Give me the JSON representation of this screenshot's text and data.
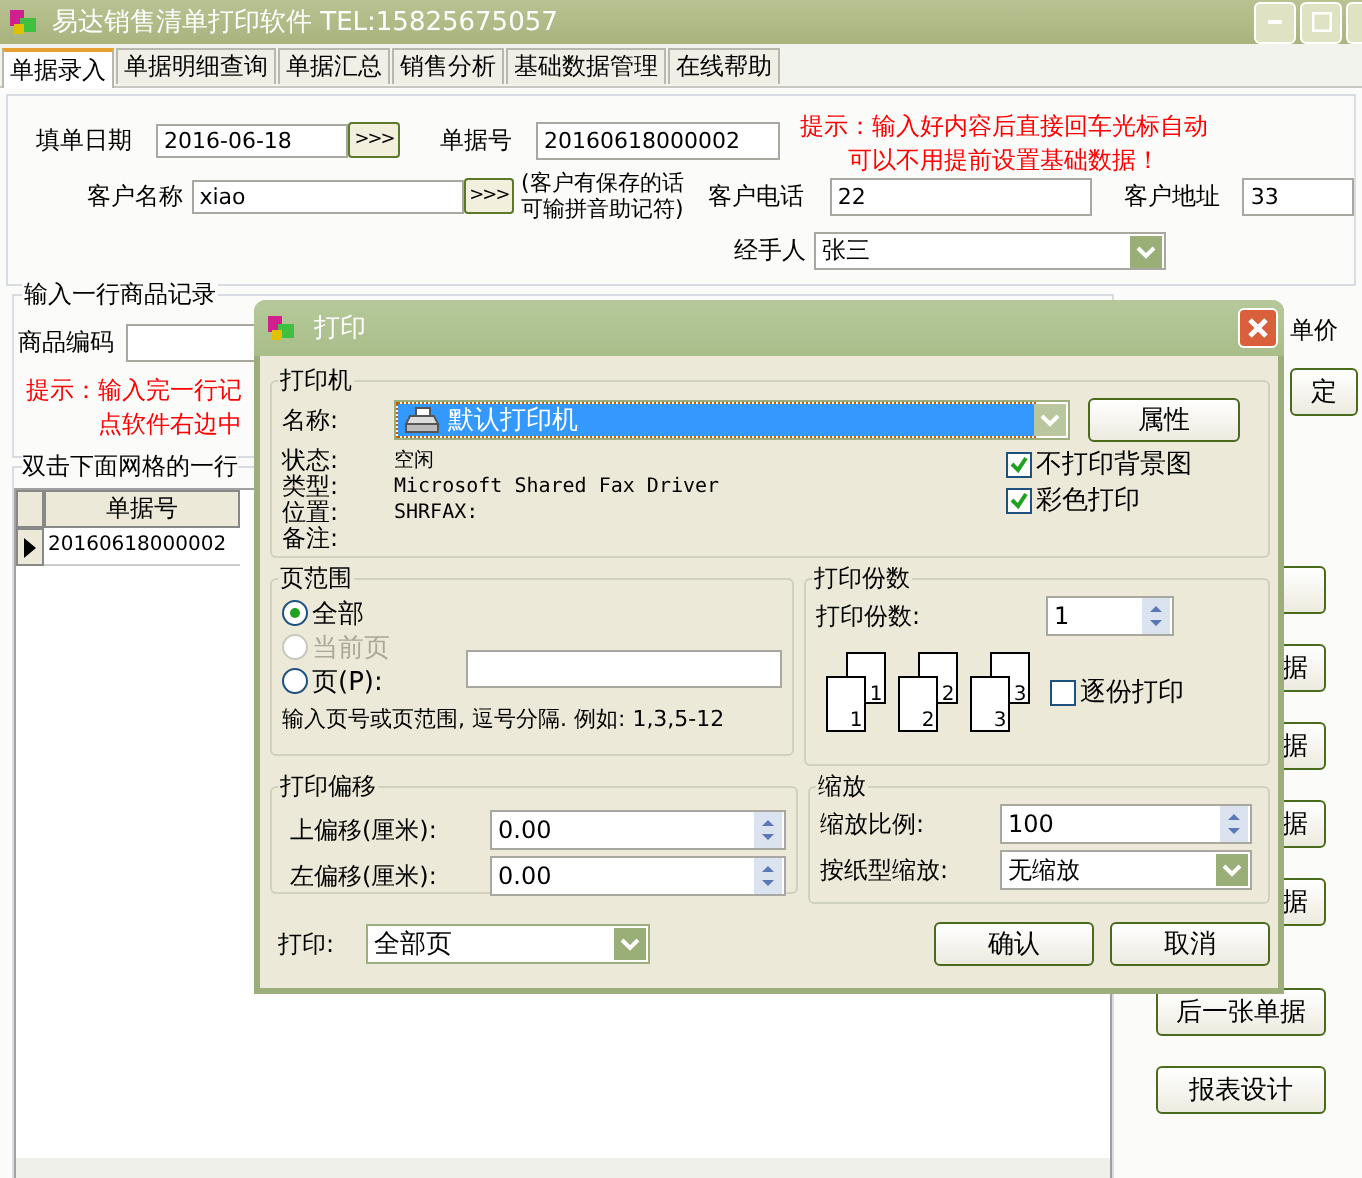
{
  "window": {
    "title": "易达销售清单打印软件 TEL:15825675057"
  },
  "tabs": [
    {
      "label": "单据录入",
      "selected": true
    },
    {
      "label": "单据明细查询",
      "selected": false
    },
    {
      "label": "单据汇总",
      "selected": false
    },
    {
      "label": "销售分析",
      "selected": false
    },
    {
      "label": "基础数据管理",
      "selected": false
    },
    {
      "label": "在线帮助",
      "selected": false
    }
  ],
  "form": {
    "date_label": "填单日期",
    "date": "2016-06-18",
    "date_button": ">>>",
    "number_label": "单据号",
    "number": "20160618000002",
    "customer_label": "客户名称",
    "customer": "xiao",
    "customer_button": ">>>",
    "customer_note_lines": [
      "(客户有保存的话",
      "可输拼音助记符)"
    ],
    "phone_label": "客户电话",
    "phone": "22",
    "address_label": "客户地址",
    "address": "33",
    "handler_label": "经手人",
    "handler": "张三",
    "hint_lines": [
      "提示：输入好内容后直接回车光标自动",
      "可以不用提前设置基础数据！"
    ]
  },
  "item_group": {
    "title": "输入一行商品记录",
    "code_label": "商品编码",
    "price_label": "单价",
    "confirm_button": "定",
    "hint_lines": [
      "提示：输入完一行记",
      "点软件右边中"
    ]
  },
  "grid": {
    "title": "双击下面网格的一行",
    "columns": [
      "单据号"
    ],
    "rows": [
      {
        "cells": [
          "20160618000002"
        ],
        "selected": true
      }
    ]
  },
  "side_buttons": [
    {
      "label": "据"
    },
    {
      "label": "据"
    },
    {
      "label": "据"
    },
    {
      "label": "据"
    },
    {
      "label": "后一张单据"
    },
    {
      "label": "报表设计"
    }
  ],
  "print_dialog": {
    "title": "打印",
    "printer": {
      "title": "打印机",
      "name_label": "名称:",
      "name": "默认打印机",
      "properties_button": "属性",
      "info": [
        {
          "label": "状态:",
          "value": "空闲"
        },
        {
          "label": "类型:",
          "value": "Microsoft Shared Fax Driver"
        },
        {
          "label": "位置:",
          "value": "SHRFAX:"
        },
        {
          "label": "备注:"
        }
      ],
      "options": [
        {
          "label": "不打印背景图",
          "checked": true
        },
        {
          "label": "彩色打印",
          "checked": true
        }
      ]
    },
    "page_range": {
      "title": "页范围",
      "options": [
        {
          "label": "全部",
          "selected": true,
          "disabled": false
        },
        {
          "label": "当前页",
          "selected": false,
          "disabled": true
        },
        {
          "label": "页(P):",
          "selected": false,
          "disabled": false
        }
      ],
      "hint": "输入页号或页范围, 逗号分隔. 例如: 1,3,5-12"
    },
    "copies": {
      "title": "打印份数",
      "label": "打印份数:",
      "value": "1",
      "stacks": [
        {
          "back": "1",
          "front": "1"
        },
        {
          "back": "2",
          "front": "2"
        },
        {
          "back": "3",
          "front": "3"
        }
      ],
      "collate": {
        "label": "逐份打印",
        "checked": false
      }
    },
    "offset": {
      "title": "打印偏移",
      "fields": [
        {
          "label": "上偏移(厘米):",
          "value": "0.00"
        },
        {
          "label": "左偏移(厘米):",
          "value": "0.00"
        }
      ]
    },
    "zoom": {
      "title": "缩放",
      "scale_label": "缩放比例:",
      "scale": "100",
      "fit_label": "按纸型缩放:",
      "fit": "无缩放"
    },
    "print_label": "打印:",
    "print_value": "全部页",
    "buttons": [
      "确认",
      "取消"
    ]
  }
}
